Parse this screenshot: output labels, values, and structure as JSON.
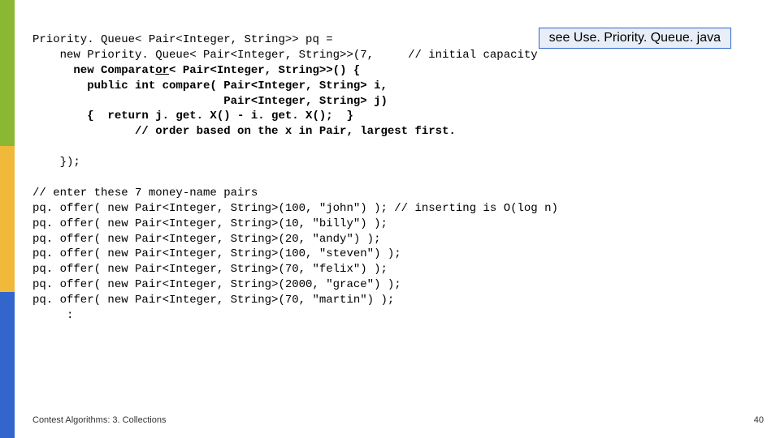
{
  "badge": "see Use. Priority. Queue. java",
  "line1a": "Priority. Queue< Pair<Integer, String>> pq =",
  "line2a": "    new Priority. Queue< Pair<Integer, String>>(7,     // initial capacity",
  "line3a": "      new Comparat",
  "line3u": "or",
  "line3b": "< Pair<Integer, String>>() {",
  "line3c": "        public int compare( Pair<Integer, String> i,",
  "line3d": "                            Pair<Integer, String> j)",
  "line3e": "        {  return j. get. X() - i. get. X();  }",
  "line3f": "               // order based on the x in Pair, largest first.",
  "line4": "    });",
  "comment2": "// enter these 7 money-name pairs",
  "offer1a": "pq. offer( new Pair<Integer, String>(100, \"john\") ); // inserting is O(log n)",
  "offer2": "pq. offer( new Pair<Integer, String>(10, \"billy\") );",
  "offer3": "pq. offer( new Pair<Integer, String>(20, \"andy\") );",
  "offer4": "pq. offer( new Pair<Integer, String>(100, \"steven\") );",
  "offer5": "pq. offer( new Pair<Integer, String>(70, \"felix\") );",
  "offer6": "pq. offer( new Pair<Integer, String>(2000, \"grace\") );",
  "offer7": "pq. offer( new Pair<Integer, String>(70, \"martin\") );",
  "colon": "     :",
  "footer_left": "Contest Algorithms: 3. Collections",
  "footer_right": "40"
}
